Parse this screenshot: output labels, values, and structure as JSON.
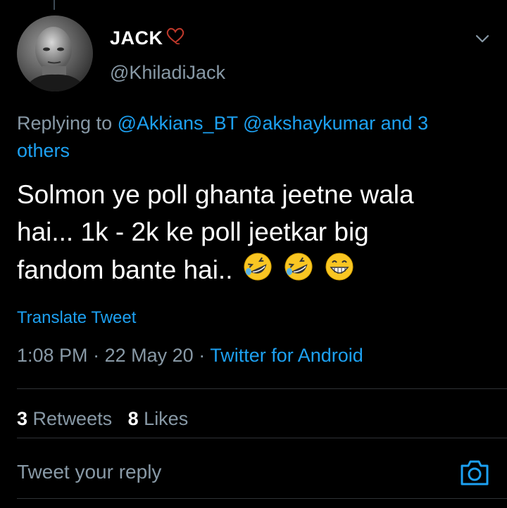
{
  "tweet": {
    "author": {
      "display_name": "JACK",
      "handle": "@KhiladiJack"
    },
    "replying_to": {
      "prefix": "Replying to",
      "mentions": [
        "@Akkians_BT",
        "@akshaykumar"
      ],
      "others": "and 3 others"
    },
    "text": {
      "line1": "Solmon ye poll ghanta jeetne wala",
      "line2": "hai... 1k - 2k  ke poll jeetkar big",
      "line3": "fandom bante hai.."
    },
    "translate_label": "Translate Tweet",
    "time": "1:08 PM",
    "separator": "·",
    "date": "22 May 20",
    "source": "Twitter for Android",
    "stats": {
      "retweets_count": "3",
      "retweets_label": "Retweets",
      "likes_count": "8",
      "likes_label": "Likes"
    }
  },
  "reply": {
    "placeholder": "Tweet your reply"
  },
  "colors": {
    "link": "#1da1f2",
    "muted": "#8899a6",
    "background": "#000000",
    "divider": "#2f3336"
  },
  "icons": [
    "heart-icon",
    "caret-down-icon",
    "rofl-emoji-icon",
    "grin-emoji-icon",
    "camera-icon"
  ]
}
